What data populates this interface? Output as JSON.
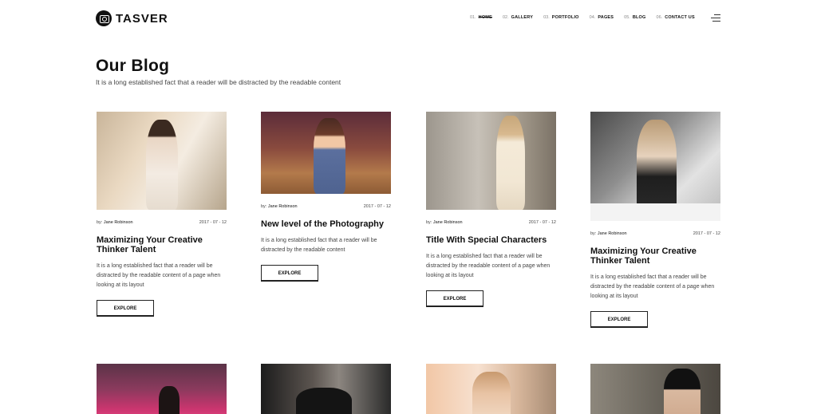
{
  "brand": {
    "name": "TASVER"
  },
  "nav": {
    "items": [
      {
        "num": "01.",
        "label": "HOME",
        "active": true
      },
      {
        "num": "02.",
        "label": "GALLERY"
      },
      {
        "num": "03.",
        "label": "PORTFOLIO"
      },
      {
        "num": "04.",
        "label": "PAGES"
      },
      {
        "num": "05.",
        "label": "BLOG"
      },
      {
        "num": "06.",
        "label": "CONTACT US"
      }
    ]
  },
  "page": {
    "title": "Our Blog",
    "subtitle": "It is a long established fact that a reader will be distracted by the readable content"
  },
  "posts": [
    {
      "by_label": "by:",
      "author": "Jane Robinson",
      "date": "2017 - 07 - 12",
      "title": "Maximizing Your Creative Thinker Talent",
      "excerpt": "It is a long established fact that a reader will be distracted by the readable content of a page when looking at its layout",
      "button": "EXPLORE"
    },
    {
      "by_label": "by:",
      "author": "Jane Robinson",
      "date": "2017 - 07 - 12",
      "title": "New level of the Photography",
      "excerpt": "It is a long established fact that a reader will be distracted by the readable content",
      "button": "EXPLORE"
    },
    {
      "by_label": "by:",
      "author": "Jane Robinson",
      "date": "2017 - 07 - 12",
      "title": "Title With Special Characters",
      "excerpt": "It is a long established fact that a reader will be distracted by the readable content of a page when looking at its layout",
      "button": "EXPLORE"
    },
    {
      "by_label": "by:",
      "author": "Jane Robinson",
      "date": "2017 - 07 - 12",
      "title": "Maximizing Your Creative Thinker Talent",
      "excerpt": "It is a long established fact that a reader will be distracted by the readable content of a page when looking at its layout",
      "button": "EXPLORE"
    }
  ],
  "icons": {
    "logo": "camera-icon",
    "menu": "hamburger-menu-icon"
  }
}
